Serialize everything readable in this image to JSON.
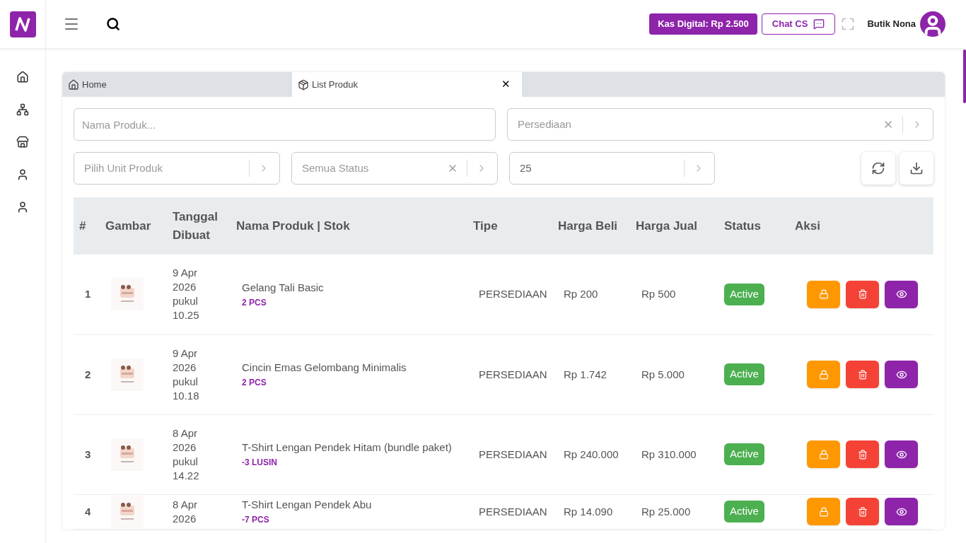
{
  "header": {
    "wallet_button": "Kas Digital: Rp 2.500",
    "chat_button": "Chat CS",
    "user_name": "Butik Nona"
  },
  "sidebar": {
    "items": [
      {
        "kind": "home"
      },
      {
        "kind": "hub"
      },
      {
        "kind": "store"
      },
      {
        "kind": "user"
      },
      {
        "kind": "user"
      }
    ]
  },
  "tabs": [
    {
      "label": "Home",
      "kind": "home",
      "selected": false
    },
    {
      "label": "List Produk",
      "kind": "box",
      "selected": true,
      "close": "✕"
    }
  ],
  "filters": {
    "name": {
      "placeholder": "Nama Produk..."
    },
    "type": {
      "placeholder": "Persediaan",
      "clearable": true
    },
    "unit": {
      "placeholder": "Pilih Unit Produk",
      "clearable": false
    },
    "status": {
      "placeholder": "Semua Status",
      "clearable": true
    },
    "per_page": {
      "value": "25",
      "clearable": false
    }
  },
  "table": {
    "columns": [
      "#",
      "Gambar",
      "Tanggal Dibuat",
      "Nama Produk | Stok",
      "Tipe",
      "Harga Beli",
      "Harga Jual",
      "Status",
      "Aksi"
    ],
    "rows": [
      {
        "no": "1",
        "date": "9 Apr 2026 pukul 10.25",
        "name": "Gelang Tali Basic",
        "stock": "2 PCS",
        "type": "PERSEDIAAN",
        "buy": "Rp 200",
        "sell": "Rp 500",
        "status": "Active",
        "active": true
      },
      {
        "no": "2",
        "date": "9 Apr 2026 pukul 10.18",
        "name": "Cincin Emas Gelombang Minimalis",
        "stock": "2 PCS",
        "type": "PERSEDIAAN",
        "buy": "Rp 1.742",
        "sell": "Rp 5.000",
        "status": "Active",
        "active": true
      },
      {
        "no": "3",
        "date": "8 Apr 2026 pukul 14.22",
        "name": "T-Shirt Lengan Pendek Hitam (bundle paket)",
        "stock": "-3 LUSIN",
        "type": "PERSEDIAAN",
        "buy": "Rp 240.000",
        "sell": "Rp 310.000",
        "status": "Active",
        "active": true
      },
      {
        "no": "4",
        "date": "8 Apr 2026",
        "name": "T-Shirt Lengan Pendek Abu",
        "stock": "-7 PCS",
        "type": "PERSEDIAAN",
        "buy": "Rp 14.090",
        "sell": "Rp 25.000",
        "status": "Active",
        "active": true
      }
    ]
  }
}
